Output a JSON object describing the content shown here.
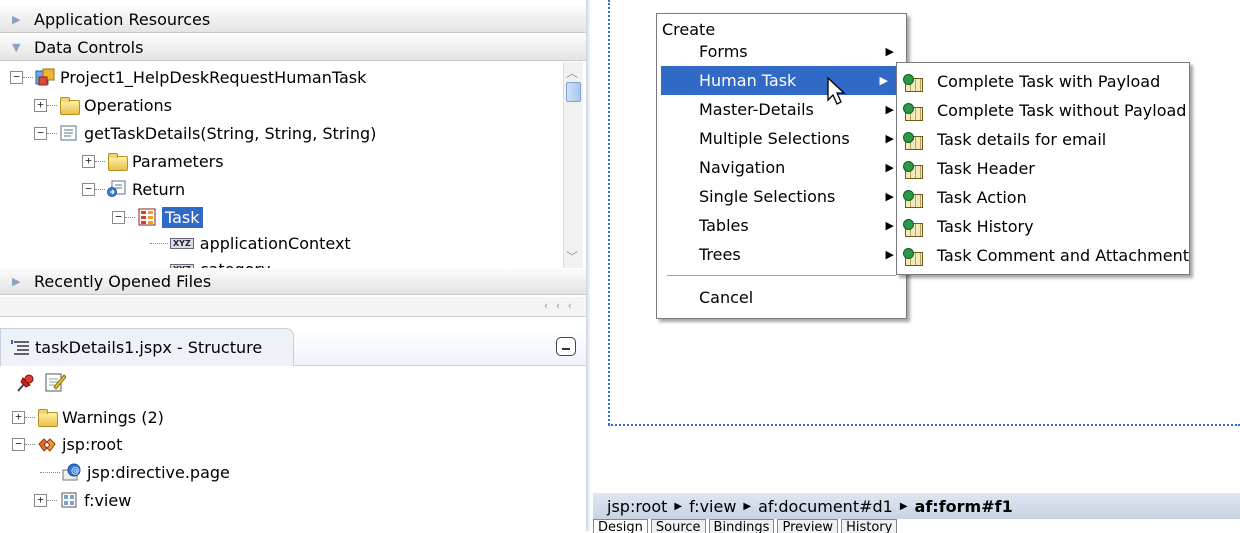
{
  "left_panel": {
    "application_resources": "Application Resources",
    "data_controls": "Data Controls",
    "recently_opened": "Recently Opened Files",
    "hscroll_arrows": "‹ ‹ ‹",
    "tree": {
      "project": "Project1_HelpDeskRequestHumanTask",
      "operations": "Operations",
      "method": "getTaskDetails(String, String, String)",
      "parameters": "Parameters",
      "return": "Return",
      "task": "Task",
      "app_context": "applicationContext",
      "category": "category",
      "xyz_label": "XYZ"
    }
  },
  "structure": {
    "tab_title": "taskDetails1.jspx - Structure",
    "tree": {
      "warnings": "Warnings (2)",
      "root": "jsp:root",
      "directive": "jsp:directive.page",
      "view": "f:view"
    }
  },
  "create_menu": {
    "title": "Create",
    "items": [
      {
        "label": "Forms"
      },
      {
        "label": "Human Task"
      },
      {
        "label": "Master-Details"
      },
      {
        "label": "Multiple Selections"
      },
      {
        "label": "Navigation"
      },
      {
        "label": "Single Selections"
      },
      {
        "label": "Tables"
      },
      {
        "label": "Trees"
      }
    ],
    "cancel": "Cancel",
    "arrow_glyph": "▶"
  },
  "human_task_submenu": {
    "items": [
      "Complete Task with Payload",
      "Complete Task without Payload",
      "Task details for email",
      "Task Header",
      "Task Action",
      "Task History",
      "Task Comment and Attachment"
    ]
  },
  "breadcrumb": {
    "items": [
      "jsp:root",
      "f:view",
      "af:document#d1",
      "af:form#f1"
    ],
    "separator": "▶"
  },
  "editor_tabs": [
    "Design",
    "Source",
    "Bindings",
    "Preview",
    "History"
  ],
  "colors": {
    "highlight": "#3169c6",
    "dotted_border": "#2f6bd0"
  }
}
